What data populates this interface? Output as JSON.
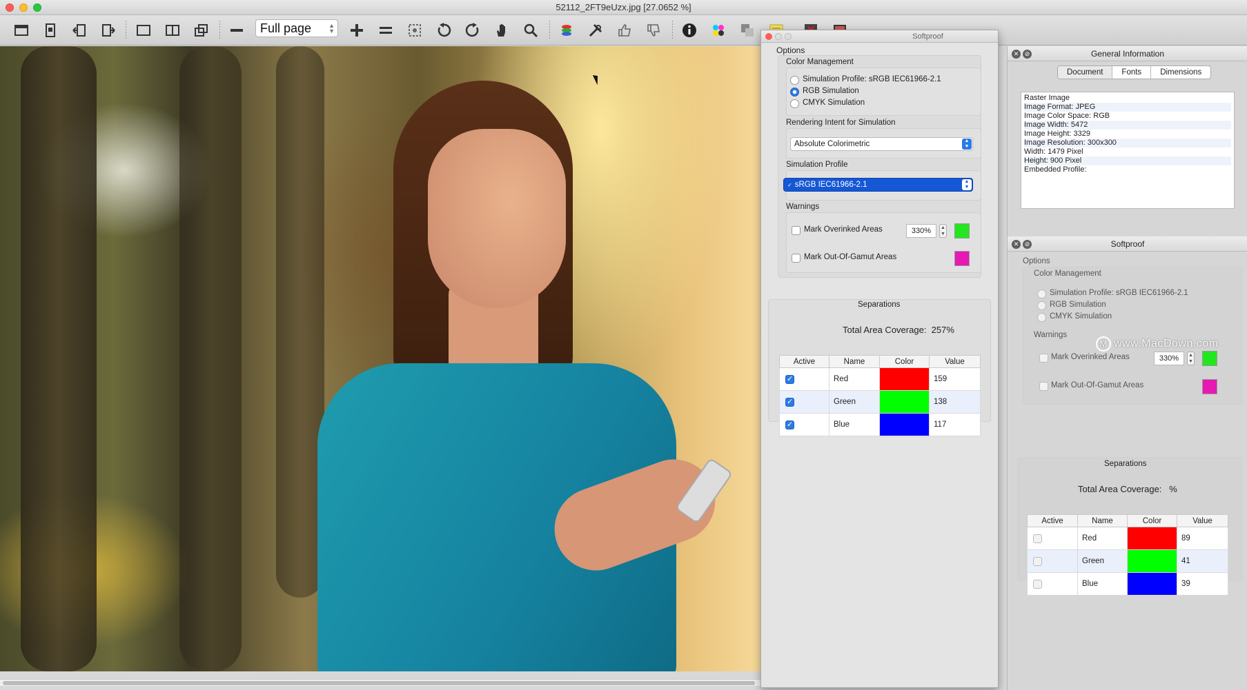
{
  "window": {
    "title": "52112_2FT9eUzx.jpg [27.0652 %]"
  },
  "toolbar": {
    "zoom_value": "Full page",
    "icons": [
      "sidebar-icon",
      "document-icon",
      "previous-page-icon",
      "next-page-icon",
      "single-page-icon",
      "two-page-icon",
      "multi-page-icon",
      "zoom-out-icon",
      "zoom-in-icon",
      "fit-width-icon",
      "selection-icon",
      "rotate-left-icon",
      "rotate-right-icon",
      "hand-icon",
      "magnifier-icon",
      "layers-icon",
      "tools-icon",
      "thumbs-up-icon",
      "thumbs-down-icon",
      "info-icon",
      "color-separation-icon",
      "overlay-icon",
      "notes-icon",
      "flag-icon",
      "display-icon"
    ]
  },
  "softproof_window": {
    "title": "Softproof",
    "options_label": "Options",
    "color_management": {
      "label": "Color Management",
      "options": [
        "Simulation Profile: sRGB IEC61966-2.1",
        "RGB Simulation",
        "CMYK Simulation"
      ],
      "selected_index": 1
    },
    "rendering_intent": {
      "label": "Rendering Intent for Simulation",
      "value": "Absolute Colorimetric"
    },
    "simulation_profile": {
      "label": "Simulation Profile",
      "value": "sRGB IEC61966-2.1"
    },
    "warnings": {
      "label": "Warnings",
      "overinked_label": "Mark Overinked Areas",
      "overinked_value": "330%",
      "overinked_color": "#22e61e",
      "gamut_label": "Mark Out-Of-Gamut Areas",
      "gamut_color": "#e619b4"
    },
    "separations": {
      "title": "Separations",
      "coverage_label": "Total Area Coverage:",
      "coverage_value": "257%",
      "headers": [
        "Active",
        "Name",
        "Color",
        "Value"
      ],
      "rows": [
        {
          "active": true,
          "name": "Red",
          "color": "#ff0000",
          "value": "159"
        },
        {
          "active": true,
          "name": "Green",
          "color": "#00ff00",
          "value": "138"
        },
        {
          "active": true,
          "name": "Blue",
          "color": "#0000ff",
          "value": "117"
        }
      ]
    }
  },
  "dock": {
    "general_info": {
      "title": "General Information",
      "tabs": [
        "Document",
        "Fonts",
        "Dimensions"
      ],
      "active_tab": 0,
      "lines": [
        "Raster Image",
        "Image Format: JPEG",
        "Image Color Space: RGB",
        "Image Width: 5472",
        "Image Height: 3329",
        "Image Resolution: 300x300",
        "Width: 1479 Pixel",
        "Height: 900 Pixel",
        "Embedded Profile:"
      ]
    },
    "softproof": {
      "title": "Softproof",
      "options_label": "Options",
      "color_management_label": "Color Management",
      "options": [
        "Simulation Profile: sRGB IEC61966-2.1",
        "RGB Simulation",
        "CMYK Simulation"
      ],
      "warnings_label": "Warnings",
      "overinked_label": "Mark Overinked Areas",
      "overinked_value": "330%",
      "overinked_color": "#22e61e",
      "gamut_label": "Mark Out-Of-Gamut Areas",
      "gamut_color": "#e619b4",
      "separations_title": "Separations",
      "coverage_label": "Total Area Coverage:",
      "coverage_value": "%",
      "headers": [
        "Active",
        "Name",
        "Color",
        "Value"
      ],
      "rows": [
        {
          "active": false,
          "name": "Red",
          "color": "#ff0000",
          "value": "89"
        },
        {
          "active": false,
          "name": "Green",
          "color": "#00ff00",
          "value": "41"
        },
        {
          "active": false,
          "name": "Blue",
          "color": "#0000ff",
          "value": "39"
        }
      ]
    }
  },
  "watermark": "www.MacDown.com"
}
